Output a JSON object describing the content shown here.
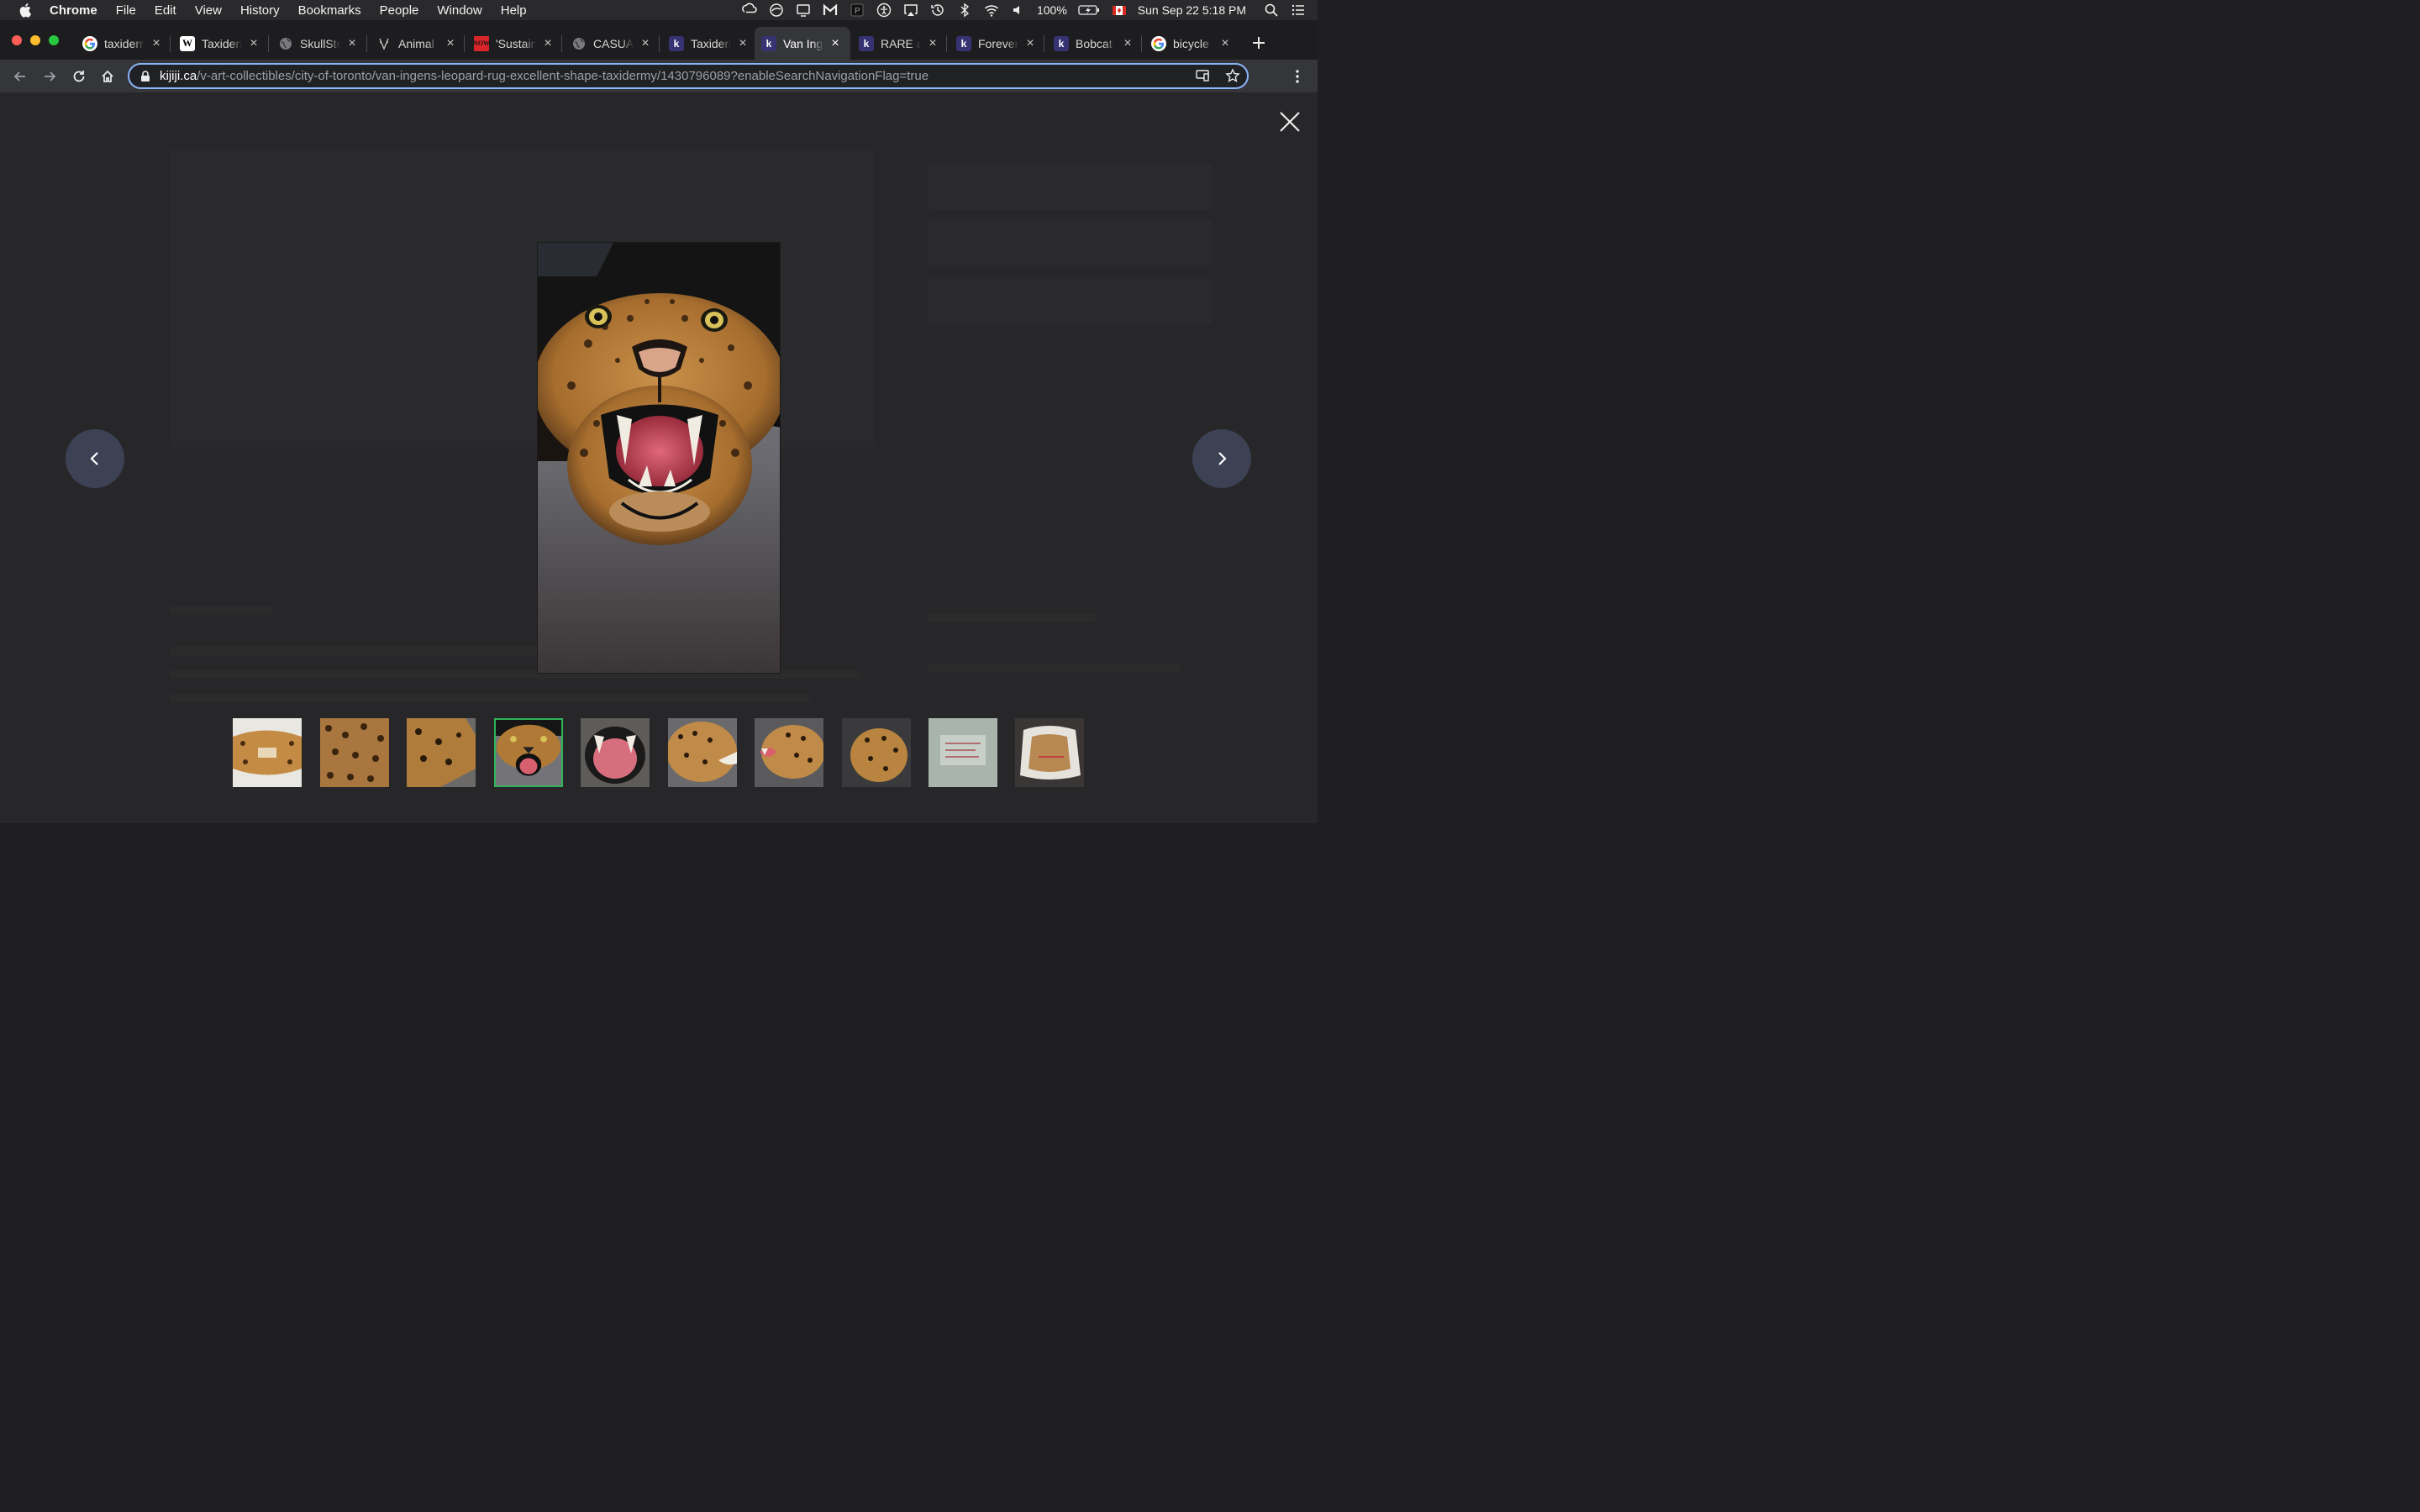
{
  "menubar": {
    "app": "Chrome",
    "items": [
      "File",
      "Edit",
      "View",
      "History",
      "Bookmarks",
      "People",
      "Window",
      "Help"
    ],
    "battery": "100%",
    "datetime": "Sun Sep 22  5:18 PM"
  },
  "tabs": [
    {
      "title": "taxiderm",
      "favicon": "google-icon"
    },
    {
      "title": "Taxiderm",
      "favicon": "wikipedia-icon"
    },
    {
      "title": "SkullSto",
      "favicon": "globe-icon"
    },
    {
      "title": "Animal",
      "favicon": "antler-icon"
    },
    {
      "title": "'Sustain",
      "favicon": "now-icon"
    },
    {
      "title": "CASUA",
      "favicon": "globe-icon"
    },
    {
      "title": "Taxiderm",
      "favicon": "kijiji-icon"
    },
    {
      "title": "Van Ing",
      "favicon": "kijiji-icon",
      "active": true
    },
    {
      "title": "RARE a",
      "favicon": "kijiji-icon"
    },
    {
      "title": "Forever",
      "favicon": "kijiji-icon"
    },
    {
      "title": "Bobcat",
      "favicon": "kijiji-icon"
    },
    {
      "title": "bicycle",
      "favicon": "google-icon"
    }
  ],
  "address": {
    "host": "kijiji.ca",
    "path": "/v-art-collectibles/city-of-toronto/van-ingens-leopard-rug-excellent-shape-taxidermy/1430796089?enableSearchNavigationFlag=true"
  },
  "gallery": {
    "selected_index": 3,
    "thumbnail_count": 10,
    "main_photo": "leopard-head-open-mouth"
  },
  "colors": {
    "selected_thumb_border": "#2fb35a",
    "arrow_button_bg": "#3d4154",
    "omnibox_focus": "#8ab4f8"
  }
}
